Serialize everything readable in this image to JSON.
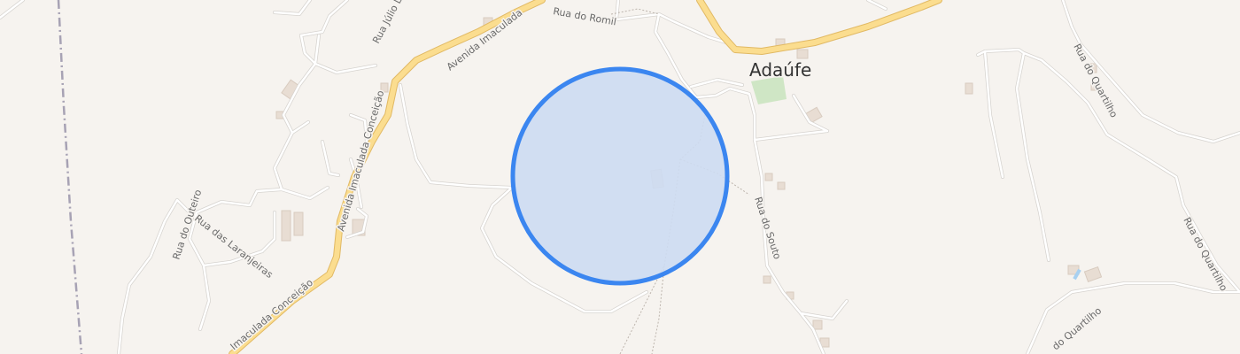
{
  "map": {
    "place": "Adaúfe",
    "streets": {
      "rua_julio_lima": "Rua Júlio Lima",
      "avenida_top": "Avenida Imaculada",
      "rua_do_romil": "Rua do Romil",
      "avenida_middle": "Avenida Imaculada Conceição",
      "rua_do_outeiro": "Rua do Outeiro",
      "rua_das_laranjeiras": "Rua das Laranjeiras",
      "avenida_bottom": "Imaculada Conceição",
      "rua_do_souto": "Rua do Souto",
      "rua_do_quartilho_1": "Rua do Quartilho",
      "rua_do_quartilho_2": "Rua do Quartilho",
      "rua_do_quartilho_3": "do Quartilho"
    },
    "colors": {
      "background": "#f6f3ef",
      "major_road": "#fbdd8f",
      "location_fill": "#cddcf2",
      "location_stroke": "#3b86f0",
      "park": "#cfe6c5",
      "railway": "#a7a2b4"
    },
    "location_marker": {
      "type": "accuracy-circle"
    }
  }
}
